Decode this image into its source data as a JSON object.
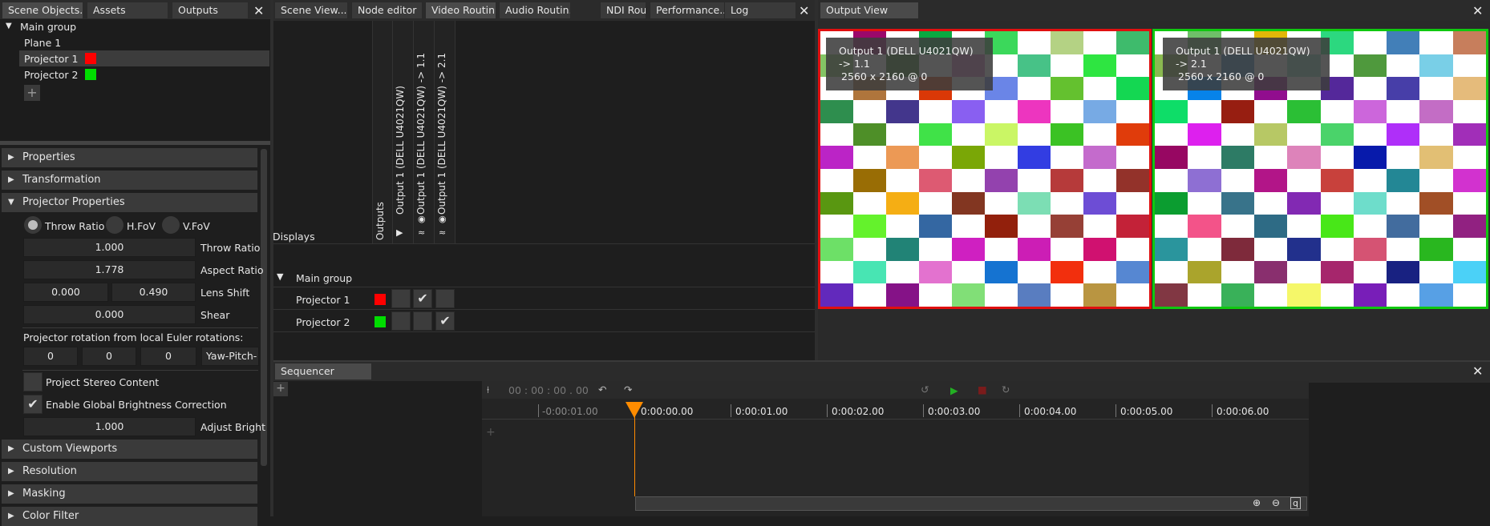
{
  "left_panel": {
    "tabs": [
      "Scene Objects...",
      "Assets",
      "Outputs"
    ],
    "tree": {
      "root": "Main group",
      "items": [
        {
          "label": "Plane 1"
        },
        {
          "label": "Projector 1",
          "color": "#ff0000"
        },
        {
          "label": "Projector 2",
          "color": "#00dd00"
        }
      ]
    },
    "sections": {
      "properties": "Properties",
      "transformation": "Transformation",
      "projector_properties": "Projector Properties",
      "custom_viewports": "Custom Viewports",
      "resolution": "Resolution",
      "masking": "Masking",
      "color_filter": "Color Filter"
    },
    "radio": {
      "throw_ratio": "Throw Ratio",
      "hfov": "H.FoV",
      "vfov": "V.FoV"
    },
    "fields": {
      "throw_ratio_value": "1.000",
      "throw_ratio_label": "Throw Ratio",
      "aspect_value": "1.778",
      "aspect_label": "Aspect Ratio",
      "lens_x": "0.000",
      "lens_y": "0.490",
      "lens_label": "Lens Shift",
      "shear_value": "0.000",
      "shear_label": "Shear",
      "rotation_heading": "Projector rotation from local Euler rotations:",
      "rot_x": "0",
      "rot_y": "0",
      "rot_z": "0",
      "rot_order": "Yaw-Pitch-R",
      "stereo_label": "Project Stereo Content",
      "brightness_label": "Enable Global Brightness Correction",
      "adjust_value": "1.000",
      "adjust_label": "Adjust Bright"
    }
  },
  "middle_panel": {
    "tabs": [
      "Scene View...",
      "Node editor",
      "Video Routin...",
      "Audio Routin...",
      "NDI Routing...",
      "Performance...",
      "Log"
    ],
    "displays_label": "Displays",
    "columns": [
      "Outputs",
      "Output 1 (DELL U4021QW)",
      "Output 1 (DELL U4021QW) -> 1.1",
      "Output 1 (DELL U4021QW) -> 2.1"
    ],
    "group": "Main group",
    "rows": [
      {
        "label": "Projector 1",
        "color": "#ff0000"
      },
      {
        "label": "Projector 2",
        "color": "#00dd00"
      }
    ]
  },
  "output_view": {
    "tab": "Output View",
    "view1": {
      "title": "Output 1 (DELL U4021QW) -> 1.1",
      "res": "2560 x 2160 @ 0",
      "border": "#e01010"
    },
    "view2": {
      "title": "Output 1 (DELL U4021QW) -> 2.1",
      "res": "2560 x 2160 @ 0",
      "border": "#10c810"
    }
  },
  "sequencer": {
    "tab": "Sequencer",
    "timecode": "00 : 00 : 00 . 00",
    "ticks": [
      "-0:00:01.00",
      "0:00:00.00",
      "0:00:01.00",
      "0:00:02.00",
      "0:00:03.00",
      "0:00:04.00",
      "0:00:05.00",
      "0:00:06.00"
    ],
    "playhead_color": "#ff8c00"
  }
}
